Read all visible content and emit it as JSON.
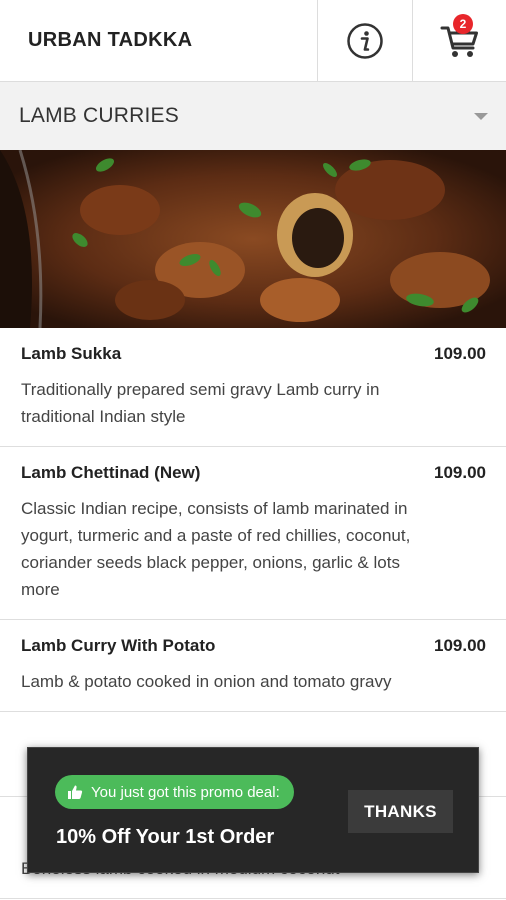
{
  "header": {
    "brand": "URBAN TADKKA",
    "cart_count": "2"
  },
  "category": {
    "title": "LAMB CURRIES"
  },
  "items": [
    {
      "name": "Lamb Sukka",
      "price": "109.00",
      "description": "Traditionally prepared semi gravy Lamb curry in traditional Indian style"
    },
    {
      "name": "Lamb Chettinad (New)",
      "price": "109.00",
      "description": "Classic Indian recipe, consists of lamb marinated in yogurt, turmeric and a paste of red chillies, coconut, coriander seeds black pepper, onions, garlic & lots more"
    },
    {
      "name": "Lamb Curry With Potato",
      "price": "109.00",
      "description": "Lamb & potato cooked in onion and tomato gravy"
    },
    {
      "name": "",
      "price": "",
      "description": ""
    },
    {
      "name": "",
      "price": "",
      "description": "Boneless lamb cooked in medium coconut"
    }
  ],
  "promo": {
    "pill_text": "You just got this promo deal:",
    "title": "10% Off Your 1st Order",
    "button_label": "THANKS"
  },
  "colors": {
    "badge": "#e8262b",
    "promo_green": "#4cbb5a",
    "toast_bg": "#272727"
  }
}
